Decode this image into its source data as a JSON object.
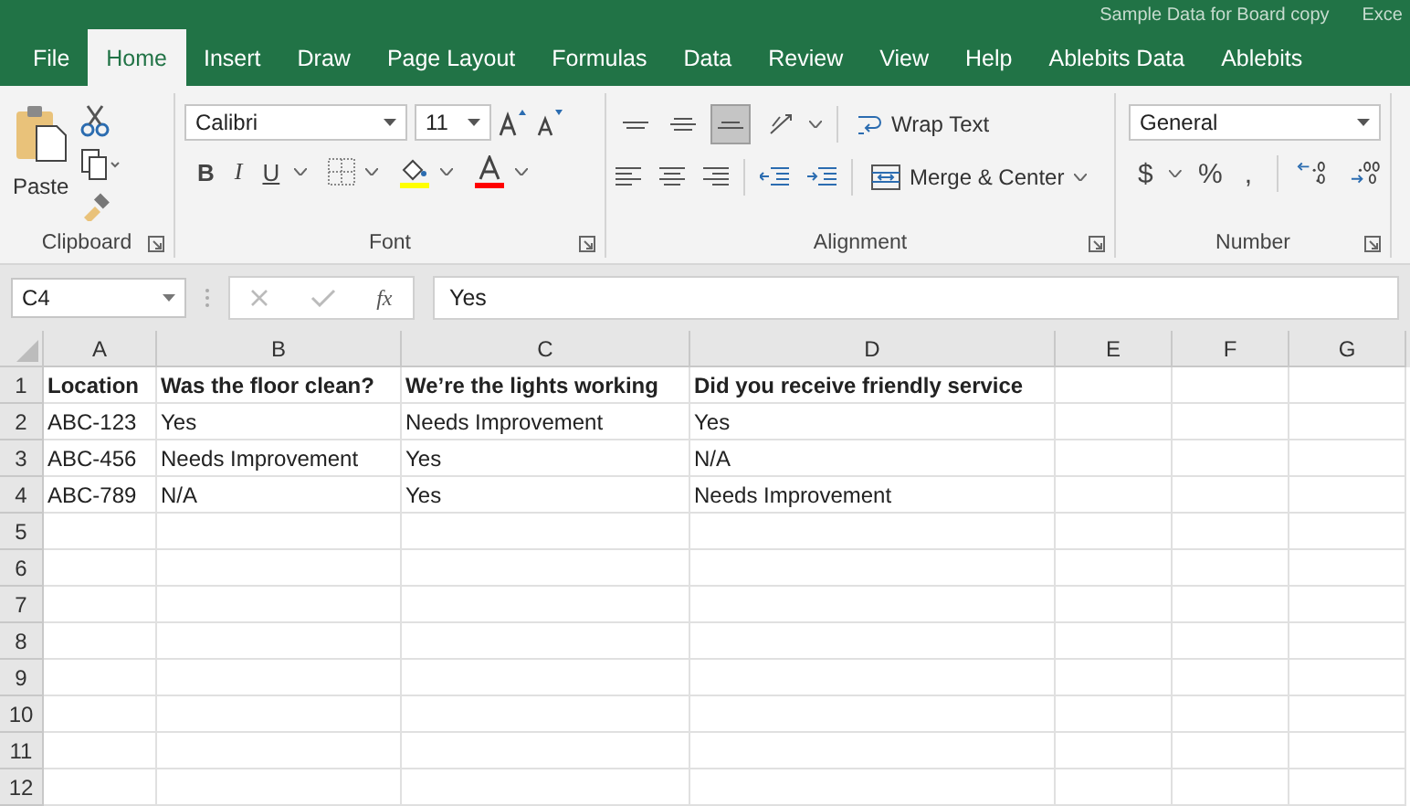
{
  "title_bar": {
    "document": "Sample Data for Board copy",
    "app": "Exce"
  },
  "tabs": [
    {
      "label": "File",
      "selected": false
    },
    {
      "label": "Home",
      "selected": true
    },
    {
      "label": "Insert",
      "selected": false
    },
    {
      "label": "Draw",
      "selected": false
    },
    {
      "label": "Page Layout",
      "selected": false
    },
    {
      "label": "Formulas",
      "selected": false
    },
    {
      "label": "Data",
      "selected": false
    },
    {
      "label": "Review",
      "selected": false
    },
    {
      "label": "View",
      "selected": false
    },
    {
      "label": "Help",
      "selected": false
    },
    {
      "label": "Ablebits Data",
      "selected": false
    },
    {
      "label": "Ablebits",
      "selected": false
    }
  ],
  "ribbon": {
    "clipboard": {
      "paste": "Paste",
      "group": "Clipboard"
    },
    "font": {
      "name": "Calibri",
      "size": "11",
      "bold": "B",
      "italic": "I",
      "underline": "U",
      "group": "Font"
    },
    "alignment": {
      "vertical": [
        {
          "kind": "top",
          "selected": false
        },
        {
          "kind": "middle",
          "selected": false
        },
        {
          "kind": "bottom",
          "selected": true
        }
      ],
      "wrap_text": "Wrap Text",
      "merge": "Merge & Center",
      "group": "Alignment"
    },
    "number": {
      "format": "General",
      "currency": "$",
      "percent": "%",
      "comma": ",",
      "group": "Number"
    }
  },
  "formula_bar": {
    "name_box": "C4",
    "fx": "fx",
    "value": "Yes"
  },
  "sheet": {
    "columns": [
      "A",
      "B",
      "C",
      "D",
      "E",
      "F",
      "G"
    ],
    "rows": [
      {
        "number": "1",
        "kind": "header",
        "cells": [
          "Location",
          "Was the floor clean?",
          "We’re the lights working",
          "Did you receive friendly service"
        ]
      },
      {
        "number": "2",
        "kind": "data",
        "cells": [
          "ABC-123",
          "Yes",
          "Needs Improvement",
          "Yes"
        ]
      },
      {
        "number": "3",
        "kind": "data",
        "cells": [
          "ABC-456",
          "Needs Improvement",
          "Yes",
          "N/A"
        ]
      },
      {
        "number": "4",
        "kind": "data",
        "cells": [
          "ABC-789",
          "N/A",
          "Yes",
          "Needs Improvement"
        ]
      },
      {
        "number": "5",
        "kind": "data"
      },
      {
        "number": "6",
        "kind": "data"
      },
      {
        "number": "7",
        "kind": "data"
      },
      {
        "number": "8",
        "kind": "data"
      },
      {
        "number": "9",
        "kind": "data"
      },
      {
        "number": "10",
        "kind": "data"
      },
      {
        "number": "11",
        "kind": "data"
      },
      {
        "number": "12",
        "kind": "data"
      }
    ]
  }
}
